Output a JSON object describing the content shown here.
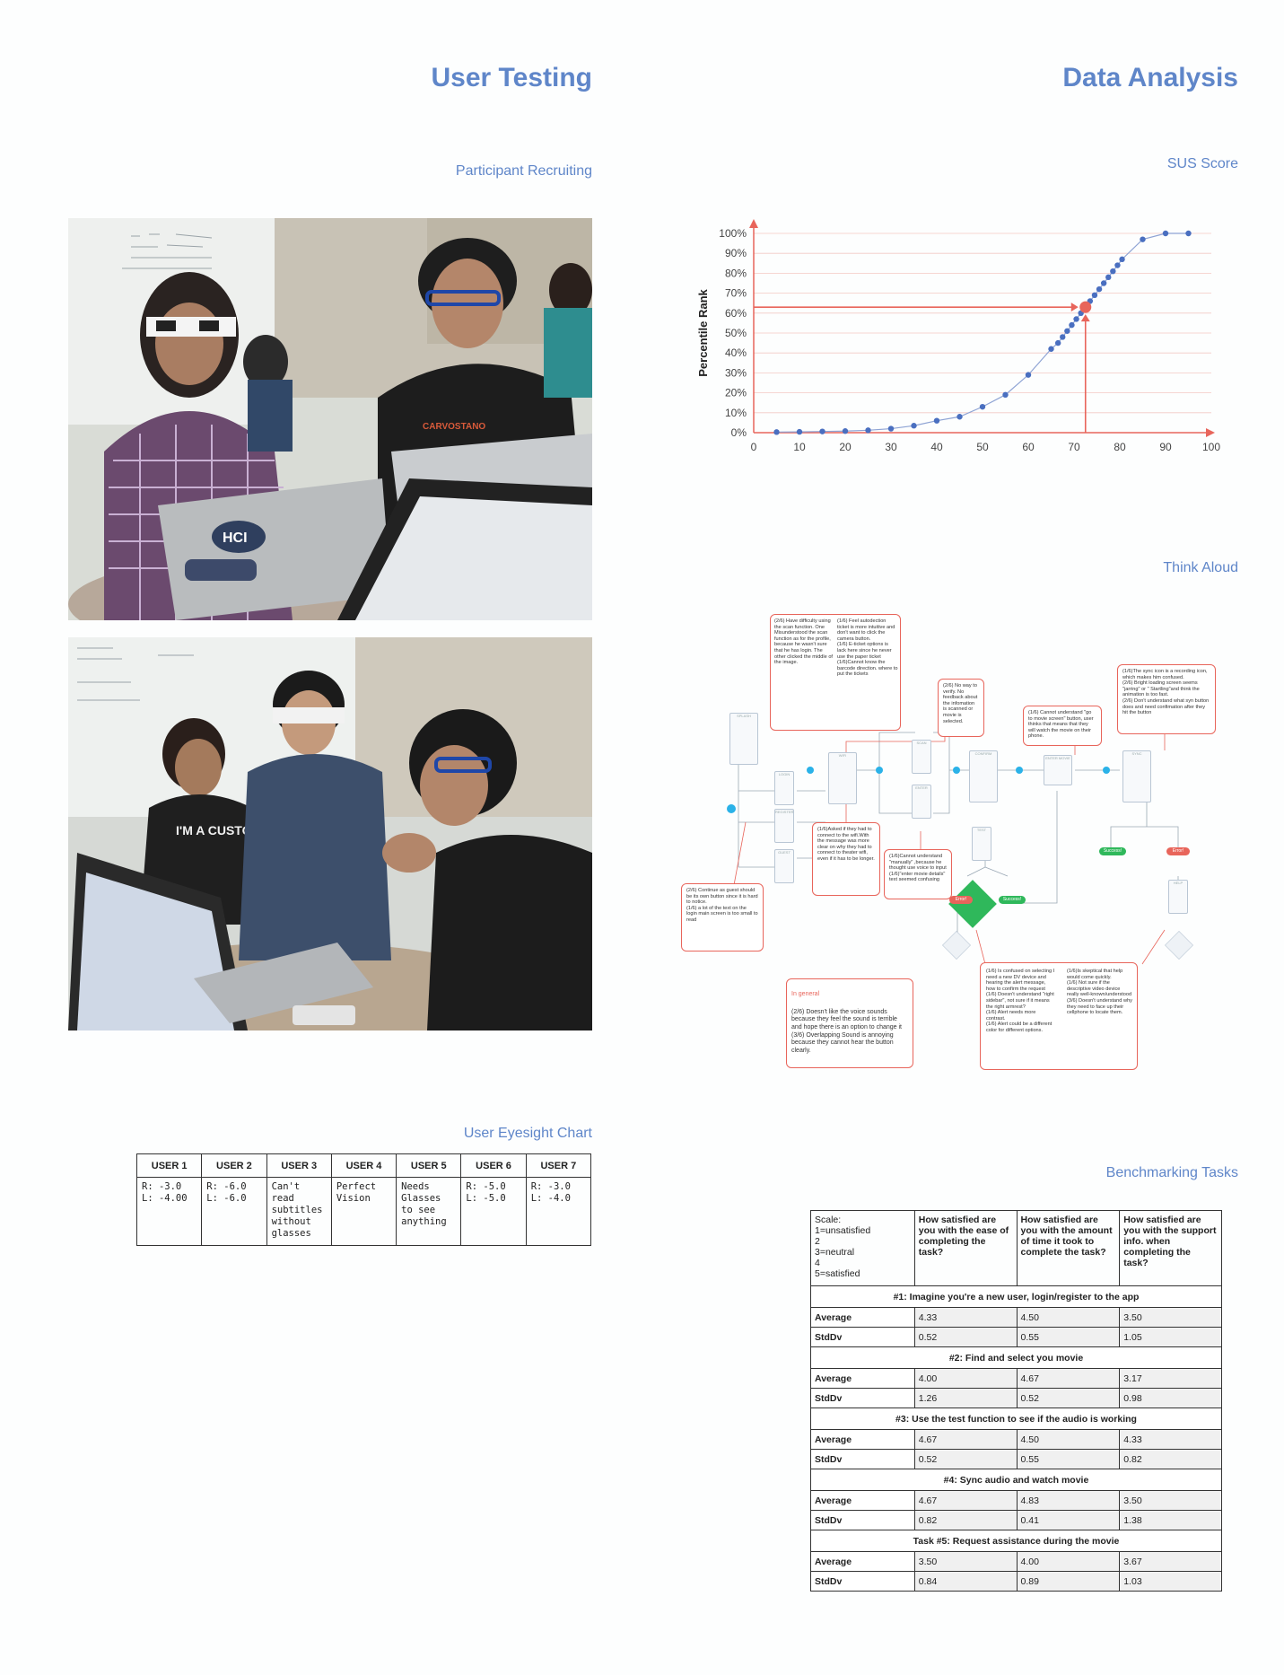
{
  "left": {
    "title": "User Testing",
    "recruiting_heading": "Participant Recruiting",
    "eyesight_heading": "User Eyesight Chart",
    "eyesight": {
      "headers": [
        "USER 1",
        "USER 2",
        "USER 3",
        "USER 4",
        "USER 5",
        "USER 6",
        "USER 7"
      ],
      "cells": [
        "R: -3.0\nL: -4.00",
        "R: -6.0\nL: -6.0",
        "Can't read subtitles without glasses",
        "Perfect Vision",
        "Needs Glasses to see anything",
        "R: -5.0\nL: -5.0",
        "R: -3.0\nL: -4.0"
      ]
    },
    "photo1": {
      "hci_sticker": "HCI"
    },
    "photo2": {
      "shirt_text": "I'M A CUSTOMER HERO."
    }
  },
  "right": {
    "title": "Data Analysis",
    "sus_heading": "SUS Score",
    "think_heading": "Think Aloud",
    "bench_heading": "Benchmarking Tasks"
  },
  "chart_data": {
    "type": "line",
    "title": "",
    "xlabel": "",
    "ylabel": "Percentile Rank",
    "xlim": [
      0,
      100
    ],
    "ylim": [
      0,
      100
    ],
    "xticks": [
      "0",
      "10",
      "20",
      "30",
      "40",
      "50",
      "60",
      "70",
      "80",
      "90",
      "100"
    ],
    "yticks": [
      "0%",
      "10%",
      "20%",
      "30%",
      "40%",
      "50%",
      "60%",
      "70%",
      "80%",
      "90%",
      "100%"
    ],
    "grid": true,
    "series": [
      {
        "x": [
          5,
          10,
          15,
          20,
          25,
          30,
          35,
          40,
          45,
          50,
          55,
          60,
          65,
          66.5,
          67.5,
          68.5,
          69.5,
          70.5,
          71.5,
          72.5,
          73.5,
          74.5,
          75.5,
          76.5,
          77.5,
          78.5,
          79.5,
          80.5,
          85,
          90,
          95
        ],
        "y": [
          0.3,
          0.4,
          0.6,
          0.8,
          1.2,
          2,
          3.5,
          6,
          8,
          13,
          19,
          29,
          42,
          45,
          48,
          51,
          54,
          57,
          60,
          63,
          66,
          69,
          72,
          75,
          78,
          81,
          84,
          87,
          97,
          100,
          100
        ]
      }
    ],
    "highlight": {
      "x": 72.5,
      "y": 63
    }
  },
  "think_aloud": {
    "notes": {
      "n1": "(2/6) Have difficulty using the scan function. One Misunderstood the scan function as for the profile, because he wasn't sure that he has login. The other clicked the middle of the image.",
      "n2": "(1/6) Feel autodection ticket is more intuitive and don't want to click the camera button.\n(1/6) E-ticket options is lack here since he never use the paper ticket\n(1/6)Cannot know the barcode direction. where to put the tickets",
      "n3": "(2/6) No way to verify. No feedback about the infomation is scanned or movie is selected.",
      "n4": "(1/6) Cannot understand \"go to movie screen\" button, user thinks that means that they will watch the movie on their phone.",
      "n5": "(1/6)The sync icon is a recording icon, which makes him confused.\n(2/6) Bright loading screen seems \"jarring\" or \" Startling\"and think the animation is too fast.\n(2/6) Don't understand what syn button does and need confimation after they hit the button",
      "n6": "(1/6)Asked if they had to connect to the wifi.With the message was more clear on why they had to connect to theater wifi, even if it has to be longer.",
      "n7": "(1/6)Cannot understand \"manually\" ,because he thought use voice to input\n(1/6)\"enter movie details\" text seemed confusing",
      "n8": "(2/6) Continue as guest should be its own button since it is hard to notice.\n(1/6) a lot of the text on the login main screen is too small to read",
      "n9_title": "In general",
      "n9": "(2/6) Doesn't like the voice sounds because they feel the sound is terrible and hope there is an option to change it\n(3/6) Overlapping Sound is annoying because they cannot hear the button clearly.",
      "n10a": "(1/6) Is confused on selecting I need a new DV device and hearing the alert message, how to confirm the request\n(1/6) Doesn't understand \"right sidebar\", not sure if it means the right armrest?\n(1/6) Alert needs more contrast.\n(1/6) Alert could be a different color for different options.",
      "n10b": "(1/6)Is skeptical that help would come quickly.\n(1/6) Not sure if the descriptive video device really well-known/understood\n(3/6) Doesn't understand why they need to face up their cellphone to locate them."
    },
    "screens": [
      "SPLASH",
      "LOGIN",
      "REGISTER",
      "GUEST",
      "WIFI",
      "SCAN",
      "ENTER",
      "CONFIRM",
      "ENTER MOVIE",
      "SYNC",
      "TEST",
      "REQUEST",
      "HELP",
      "REQUEST"
    ],
    "pills": {
      "success": "Success!",
      "error": "Error!",
      "help": "HELP ASSIST"
    }
  },
  "benchmark": {
    "scale": "Scale:\n   1=unsatisfied\n   2\n   3=neutral\n   4\n   5=satisfied",
    "headers": [
      "How satisfied are you with the ease of completing the task?",
      "How satisfied are you with the amount of time it took to complete the task?",
      "How satisfied are you with the support info. when completing the task?"
    ],
    "avg_label": "Average",
    "sd_label": "StdDv",
    "tasks": [
      {
        "title": "#1:  Imagine you're a new user, login/register to the app",
        "avg": [
          "4.33",
          "4.50",
          "3.50"
        ],
        "sd": [
          "0.52",
          "0.55",
          "1.05"
        ]
      },
      {
        "title": "#2: Find and select you movie",
        "avg": [
          "4.00",
          "4.67",
          "3.17"
        ],
        "sd": [
          "1.26",
          "0.52",
          "0.98"
        ]
      },
      {
        "title": "#3: Use the test function to see if the audio is working",
        "avg": [
          "4.67",
          "4.50",
          "4.33"
        ],
        "sd": [
          "0.52",
          "0.55",
          "0.82"
        ]
      },
      {
        "title": "#4: Sync audio and watch movie",
        "avg": [
          "4.67",
          "4.83",
          "3.50"
        ],
        "sd": [
          "0.82",
          "0.41",
          "1.38"
        ]
      },
      {
        "title": "Task #5: Request assistance during the movie",
        "avg": [
          "3.50",
          "4.00",
          "3.67"
        ],
        "sd": [
          "0.84",
          "0.89",
          "1.03"
        ]
      }
    ]
  },
  "colors": {
    "heading": "#5f86c9",
    "accent_red": "#e8655b",
    "chart_blue": "#4a6fc0"
  }
}
